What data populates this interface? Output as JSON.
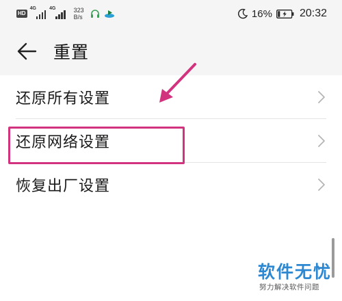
{
  "status_bar": {
    "hd": "HD",
    "network1": "4G",
    "network2": "4G",
    "speed_value": "323",
    "speed_unit": "B/s",
    "battery_pct": "16%",
    "battery_level": 0.16,
    "time": "20:32"
  },
  "header": {
    "title": "重置"
  },
  "list": {
    "items": [
      {
        "label": "还原所有设置"
      },
      {
        "label": "还原网络设置"
      },
      {
        "label": "恢复出厂设置"
      }
    ]
  },
  "watermark": {
    "main": "软件无忧",
    "sub": "努力解决软件问题"
  },
  "colors": {
    "annotation": "#d2337f",
    "watermark_blue": "#2d88d1",
    "page_bg": "#f5f5f5",
    "list_bg": "#ffffff"
  }
}
